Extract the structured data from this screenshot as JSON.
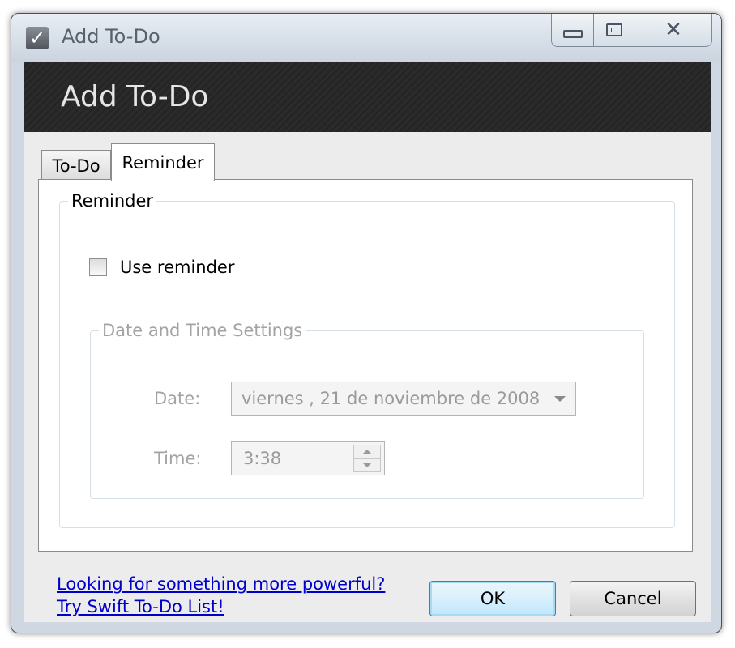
{
  "window": {
    "title": "Add To-Do",
    "icon": "checkbox-check-icon"
  },
  "banner": {
    "title": "Add To-Do"
  },
  "tabs": [
    {
      "label": "To-Do",
      "active": false
    },
    {
      "label": "Reminder",
      "active": true
    }
  ],
  "reminder_group": {
    "legend": "Reminder",
    "use_reminder_label": "Use reminder",
    "use_reminder_checked": false
  },
  "datetime_group": {
    "legend": "Date and Time Settings",
    "date_label": "Date:",
    "date_value": "viernes  , 21 de noviembre de 2008",
    "time_label": "Time:",
    "time_value": "3:38",
    "enabled": false
  },
  "footer": {
    "link_line1": "Looking for something more powerful?",
    "link_line2": "Try Swift To-Do List!",
    "ok_label": "OK",
    "cancel_label": "Cancel"
  },
  "colors": {
    "banner_bg": "#2b2b2b",
    "banner_text": "#e6e6e6",
    "link": "#0000cc",
    "disabled_text": "#a3a3a3"
  }
}
